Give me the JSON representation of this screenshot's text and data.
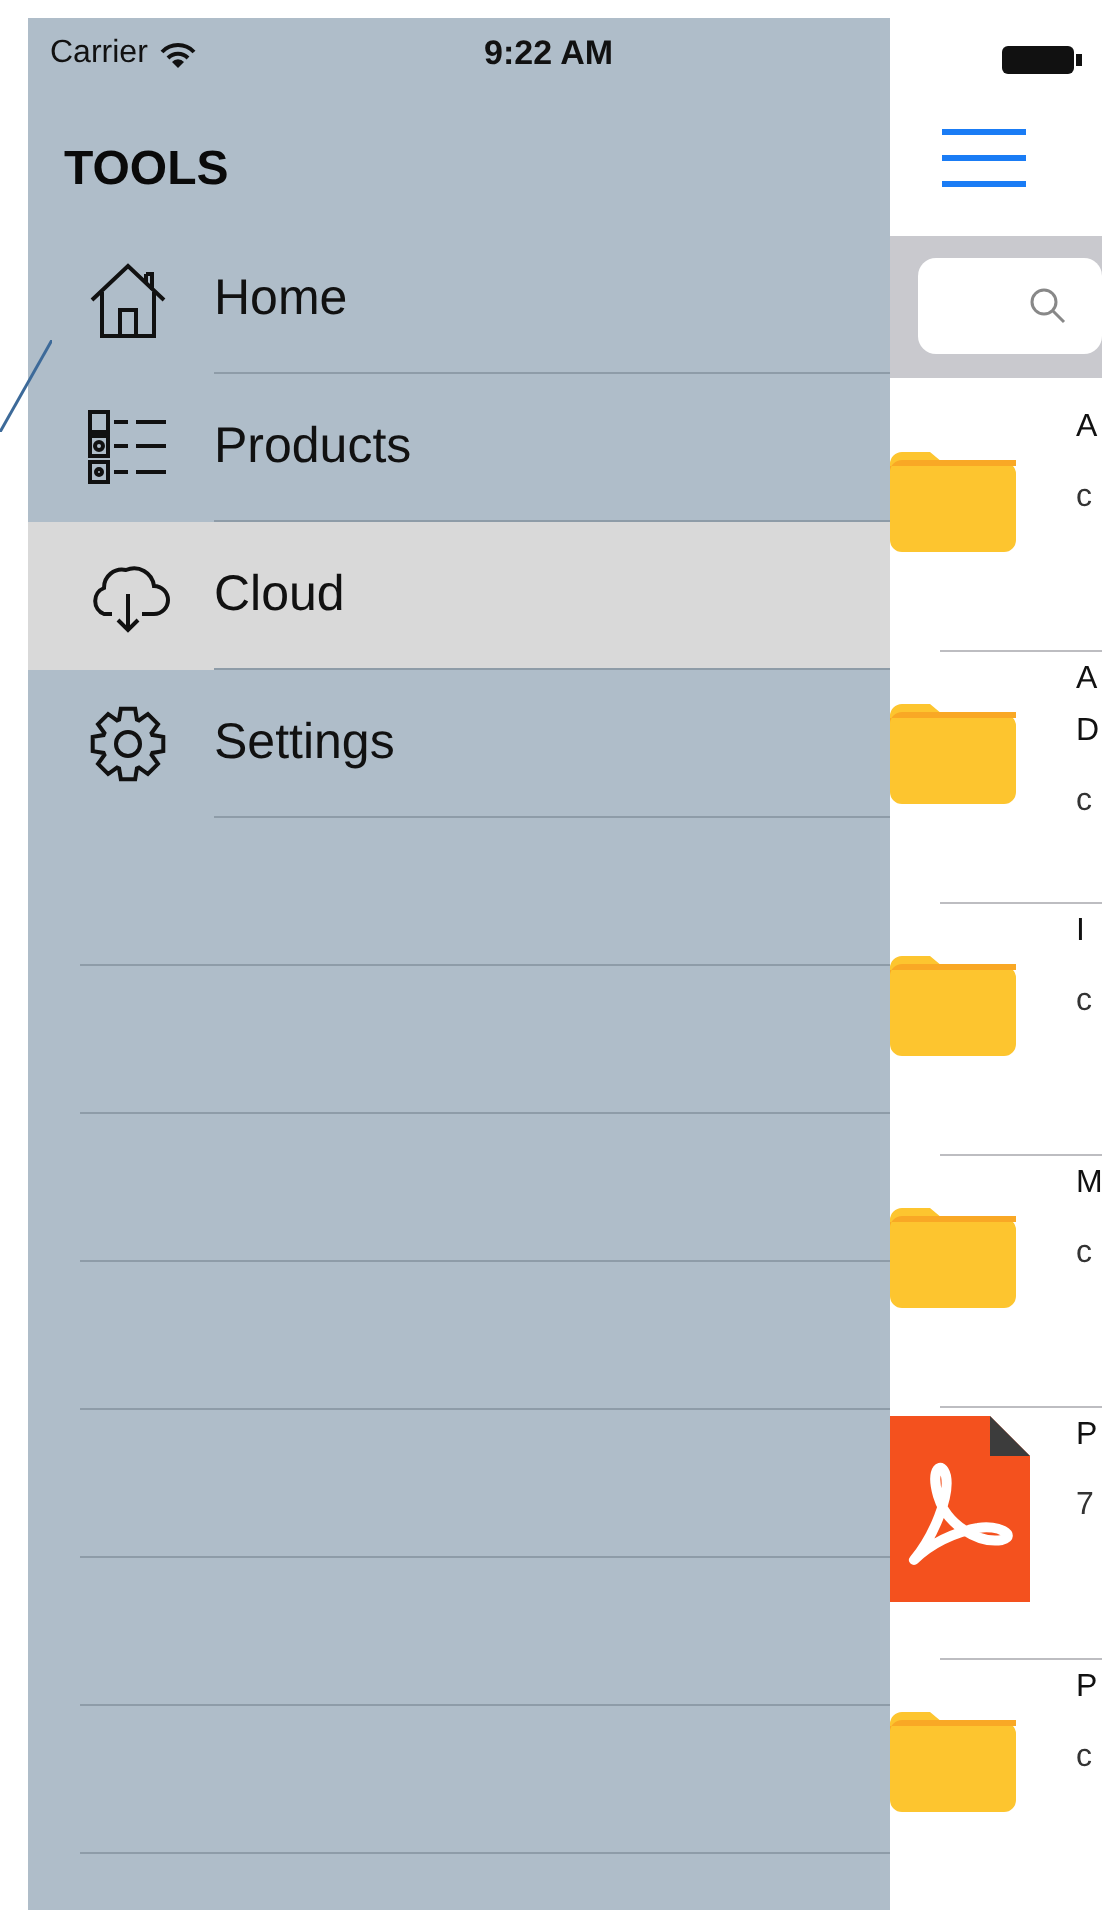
{
  "status_bar": {
    "carrier": "Carrier",
    "time": "9:22 AM"
  },
  "drawer": {
    "title": "TOOLS",
    "items": [
      {
        "label": "Home",
        "kind": "home",
        "selected": false
      },
      {
        "label": "Products",
        "kind": "list",
        "selected": false
      },
      {
        "label": "Cloud",
        "kind": "cloud",
        "selected": true
      },
      {
        "label": "Settings",
        "kind": "gear",
        "selected": false
      }
    ]
  },
  "files": [
    {
      "kind": "folder",
      "title_lines": [
        "A"
      ],
      "subtitle": "c"
    },
    {
      "kind": "folder",
      "title_lines": [
        "A",
        "D"
      ],
      "subtitle": "c"
    },
    {
      "kind": "folder",
      "title_lines": [
        "I"
      ],
      "subtitle": "c"
    },
    {
      "kind": "folder",
      "title_lines": [
        "M"
      ],
      "subtitle": "c"
    },
    {
      "kind": "pdf",
      "title_lines": [
        "P"
      ],
      "subtitle": "7"
    },
    {
      "kind": "folder",
      "title_lines": [
        "P"
      ],
      "subtitle": "c"
    }
  ]
}
